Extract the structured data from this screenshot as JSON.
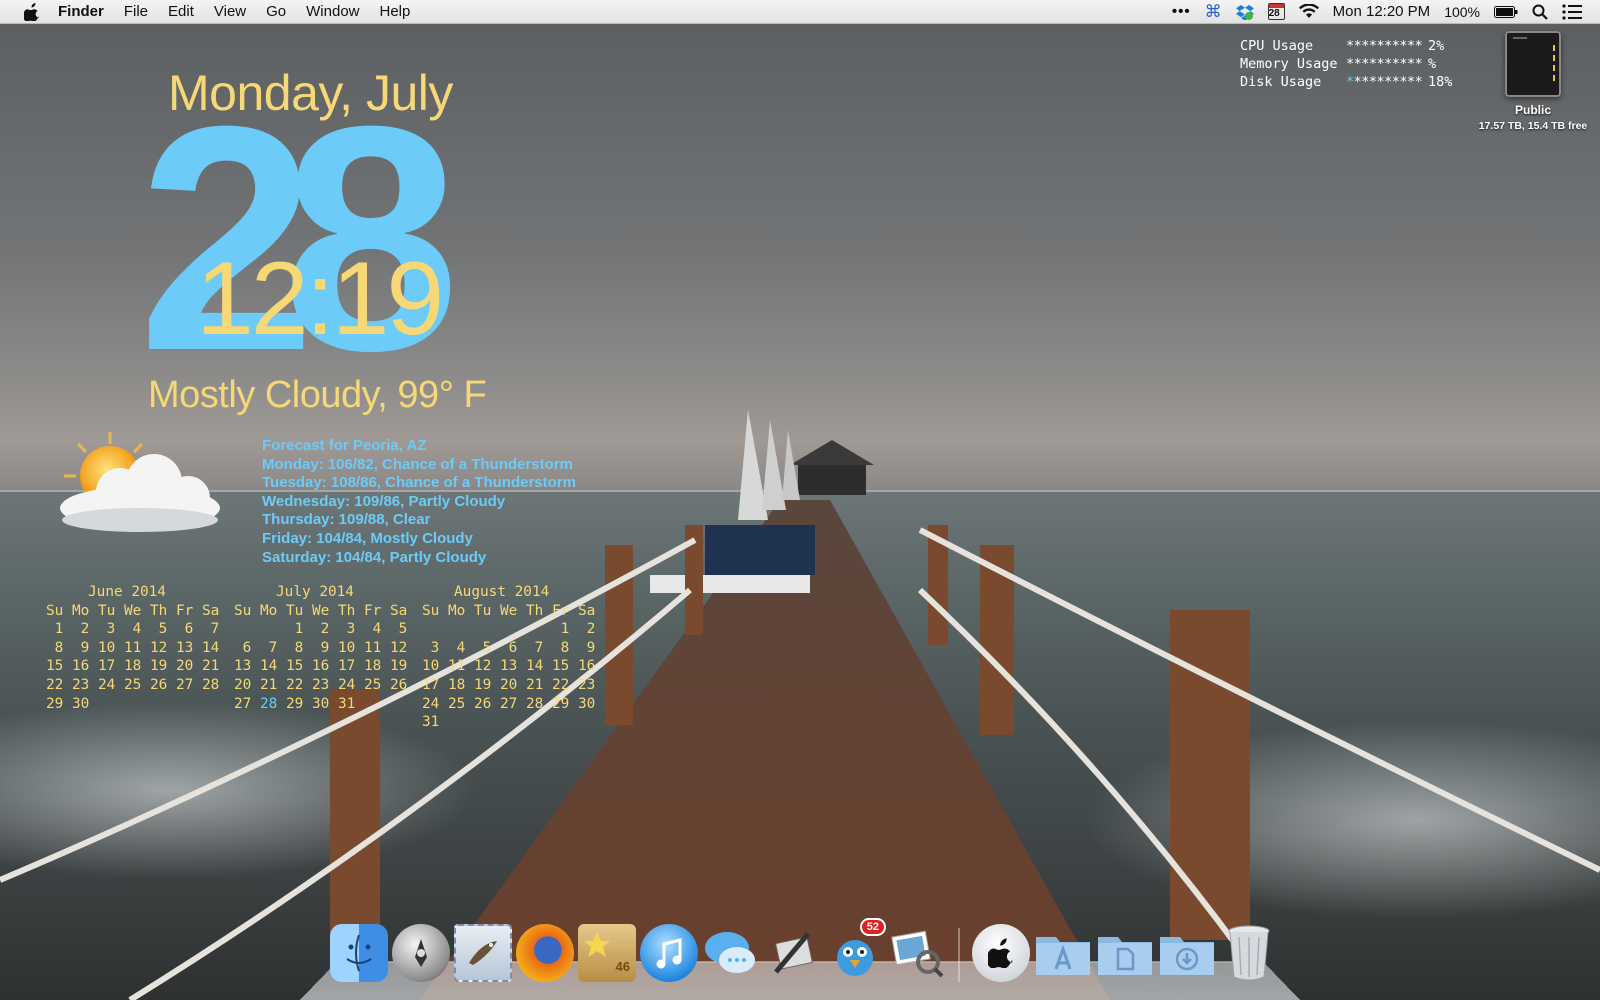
{
  "menubar": {
    "app_name": "Finder",
    "menus": [
      "File",
      "Edit",
      "View",
      "Go",
      "Window",
      "Help"
    ],
    "calendar_day": "28",
    "clock": "Mon 12:20 PM",
    "battery": "100%",
    "icons": [
      "apple-icon",
      "more-icon",
      "command-icon",
      "dropbox-icon",
      "calendar-icon",
      "wifi-icon",
      "battery-icon",
      "search-icon",
      "list-icon"
    ]
  },
  "clock_widget": {
    "day_line": "Monday, July",
    "big_date": "28",
    "time": "12:19",
    "current_weather": "Mostly Cloudy, 99° F"
  },
  "forecast": {
    "title": "Forecast for Peoria, AZ",
    "days": [
      "Monday: 106/82, Chance of a Thunderstorm",
      "Tuesday: 108/86, Chance of a Thunderstorm",
      "Wednesday: 109/86, Partly Cloudy",
      "Thursday: 109/88, Clear",
      "Friday: 104/84, Mostly Cloudy",
      "Saturday: 104/84, Partly Cloudy"
    ]
  },
  "calendars": {
    "june": {
      "title": "June 2014",
      "header": "Su Mo Tu We Th Fr Sa",
      "weeks": [
        " 1  2  3  4  5  6  7",
        " 8  9 10 11 12 13 14",
        "15 16 17 18 19 20 21",
        "22 23 24 25 26 27 28",
        "29 30"
      ]
    },
    "july": {
      "title": "July 2014",
      "header": "Su Mo Tu We Th Fr Sa",
      "weeks": [
        "       1  2  3  4  5",
        " 6  7  8  9 10 11 12",
        "13 14 15 16 17 18 19",
        "20 21 22 23 24 25 26"
      ],
      "last_week_before": "27 ",
      "today": "28",
      "last_week_after": " 29 30 31"
    },
    "august": {
      "title": "August 2014",
      "header": "Su Mo Tu We Th Fr Sa",
      "weeks": [
        "                1  2",
        " 3  4  5  6  7  8  9",
        "10 11 12 13 14 15 16",
        "17 18 19 20 21 22 23",
        "24 25 26 27 28 29 30",
        "31"
      ]
    }
  },
  "system_stats": {
    "rows": [
      {
        "label": "CPU Usage",
        "bar": "**********",
        "value": "2%"
      },
      {
        "label": "Memory Usage",
        "bar": "**********",
        "value": "%"
      },
      {
        "label": "Disk Usage",
        "bar": "**********",
        "value": "18%"
      }
    ],
    "disk_bar_fill": 0.18,
    "accent_color": "#6ccbf8"
  },
  "drive": {
    "name": "Public",
    "capacity": "17.57 TB, 15.4 TB free"
  },
  "dock": {
    "items": [
      {
        "name": "finder-icon"
      },
      {
        "name": "launchpad-icon"
      },
      {
        "name": "mail-icon"
      },
      {
        "name": "firefox-icon"
      },
      {
        "name": "deliveries-icon",
        "badge": "46"
      },
      {
        "name": "itunes-icon"
      },
      {
        "name": "messages-icon"
      },
      {
        "name": "utilities-icon"
      },
      {
        "name": "tweetbot-icon",
        "badge": "52"
      },
      {
        "name": "preview-icon"
      },
      {
        "name": "apple-folder-icon"
      },
      {
        "name": "applications-folder-icon"
      },
      {
        "name": "documents-folder-icon"
      },
      {
        "name": "downloads-folder-icon"
      },
      {
        "name": "trash-icon"
      }
    ]
  },
  "colors": {
    "yellow_text": "#f6d877",
    "blue_text": "#6ccbf8"
  }
}
